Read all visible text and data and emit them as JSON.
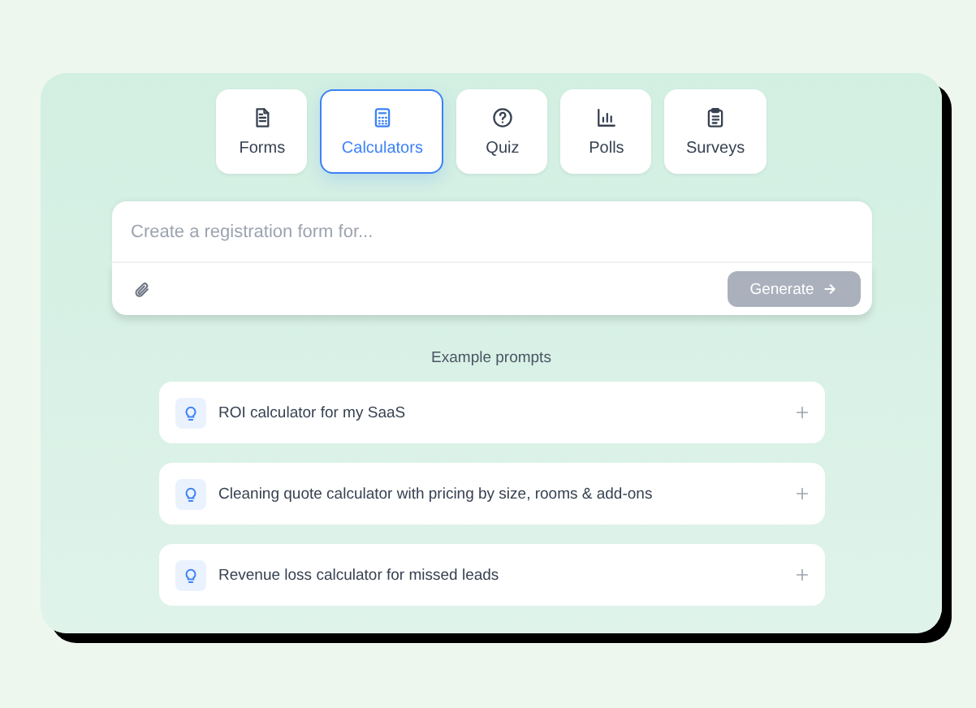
{
  "tabs": [
    {
      "label": "Forms",
      "kind": "document",
      "selected": false
    },
    {
      "label": "Calculators",
      "kind": "calculator",
      "selected": true
    },
    {
      "label": "Quiz",
      "kind": "question",
      "selected": false
    },
    {
      "label": "Polls",
      "kind": "chart",
      "selected": false
    },
    {
      "label": "Surveys",
      "kind": "clipboard",
      "selected": false
    }
  ],
  "prompt": {
    "placeholder": "Create a registration form for...",
    "generate": {
      "label": "Generate",
      "disabled": true
    }
  },
  "examples": {
    "title": "Example prompts",
    "items": [
      {
        "text": "ROI calculator for my SaaS"
      },
      {
        "text": "Cleaning quote calculator with pricing by size, rooms & add-ons"
      },
      {
        "text": "Revenue loss calculator for missed leads"
      }
    ]
  }
}
